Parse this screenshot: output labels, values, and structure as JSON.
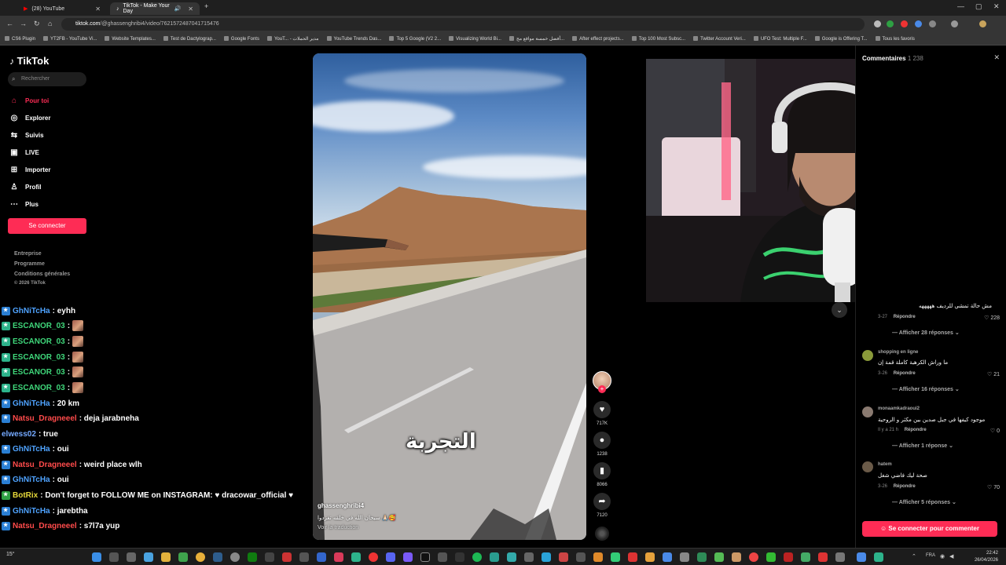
{
  "browser": {
    "tabs": [
      {
        "label": "(28) YouTube",
        "active": false
      },
      {
        "label": "TikTok - Make Your Day",
        "active": true
      }
    ],
    "url_domain": "tiktok.com",
    "url_path": "/@ghassenghribi4/video/7621572487041715476",
    "bookmarks": [
      "CS6 Plugin",
      "YT2FB - YouTube Vi...",
      "Website Templates...",
      "Test de Dactylograp...",
      "Google Fonts",
      "YouT... - مدير الحملات",
      "YouTube Trends Das...",
      "Top 5 Google (V2 2...",
      "Visualizing World Bi...",
      "أفضل خمسة مواقع مج...",
      "After effect projects...",
      "Top 100 Most Subsc...",
      "Twitter Account Veri...",
      "UFO Test: Multiple F...",
      "Google is Offering T...",
      "Tous les favoris"
    ]
  },
  "tiktok": {
    "logo": "TikTok",
    "search_placeholder": "Rechercher",
    "nav": [
      {
        "label": "Pour toi",
        "icon": "home-icon"
      },
      {
        "label": "Explorer",
        "icon": "compass-icon"
      },
      {
        "label": "Suivis",
        "icon": "following-icon"
      },
      {
        "label": "LIVE",
        "icon": "live-icon"
      },
      {
        "label": "Importer",
        "icon": "upload-icon"
      },
      {
        "label": "Profil",
        "icon": "profile-icon"
      },
      {
        "label": "Plus",
        "icon": "more-icon"
      }
    ],
    "login_button": "Se connecter",
    "footer_links": [
      "Entreprise",
      "Programme",
      "Conditions générales",
      "© 2026 TikTok"
    ]
  },
  "chat": [
    {
      "user": "GhNiTcHa",
      "msg": ": eyhh",
      "type": "gh"
    },
    {
      "user": "ESCANOR_03",
      "msg": " :",
      "type": "es",
      "emote": true
    },
    {
      "user": "ESCANOR_03",
      "msg": " :",
      "type": "es",
      "emote": true
    },
    {
      "user": "ESCANOR_03",
      "msg": " :",
      "type": "es",
      "emote": true
    },
    {
      "user": "ESCANOR_03",
      "msg": " :",
      "type": "es",
      "emote": true
    },
    {
      "user": "ESCANOR_03",
      "msg": " :",
      "type": "es",
      "emote": true
    },
    {
      "user": "GhNiTcHa",
      "msg": ": 20 km",
      "type": "gh"
    },
    {
      "user": "Natsu_Dragneeel",
      "msg": ": deja jarabneha",
      "type": "na"
    },
    {
      "user": "elwess02",
      "msg": ": true",
      "type": "el"
    },
    {
      "user": "GhNiTcHa",
      "msg": ": oui",
      "type": "gh"
    },
    {
      "user": "Natsu_Dragneeel",
      "msg": ": weird place wlh",
      "type": "na"
    },
    {
      "user": "GhNiTcHa",
      "msg": ": oui",
      "type": "gh"
    },
    {
      "user": "BotRix",
      "msg": ": Don't forget to FOLLOW ME on INSTAGRAM: ♥ dracowar_official ♥",
      "type": "bo"
    },
    {
      "user": "GhNiTcHa",
      "msg": ": jarebtha",
      "type": "gh"
    },
    {
      "user": "Natsu_Dragneeel",
      "msg": ": s7l7a yup",
      "type": "na"
    }
  ],
  "video": {
    "caption_overlay": "التجربة",
    "author": "ghassenghribi4",
    "description": "سبحان الله في خلقه تغزدوا 🙏🏻🥰",
    "translate_link": "Voir la traduction"
  },
  "actions": [
    {
      "icon": "heart-icon",
      "count": "717K"
    },
    {
      "icon": "comment-icon",
      "count": "1238"
    },
    {
      "icon": "bookmark-icon",
      "count": "8066"
    },
    {
      "icon": "share-icon",
      "count": "7120"
    }
  ],
  "comments": {
    "title": "Commentaires",
    "count": "1 238",
    "items": [
      {
        "user": "",
        "text": "مش حالة تمشي للرديف هههههه",
        "date": "3-27",
        "reply": "Répondre",
        "likes": "228",
        "replies": "Afficher 28 réponses"
      },
      {
        "user": "shopping en ligne",
        "text": "ما وراش الكرهبة كاملة قمة إن",
        "date": "3-26",
        "reply": "Répondre",
        "likes": "21",
        "replies": "Afficher 16 réponses"
      },
      {
        "user": "monaamkadraoui2",
        "text": "موجود كيفها في جبل صدين بين مكثر و الروحية",
        "date": "Il y a 21 h",
        "reply": "Répondre",
        "likes": "0",
        "replies": "Afficher 1 réponse"
      },
      {
        "user": "hatem",
        "text": "صحة ليك فاضي شغل",
        "date": "3-26",
        "reply": "Répondre",
        "likes": "70",
        "replies": "Afficher 5 réponses"
      }
    ],
    "login_button": "Se connecter pour commenter"
  },
  "taskbar": {
    "weather": "15°",
    "lang": "FRA",
    "time": "22:42",
    "date": "26/04/2026"
  }
}
